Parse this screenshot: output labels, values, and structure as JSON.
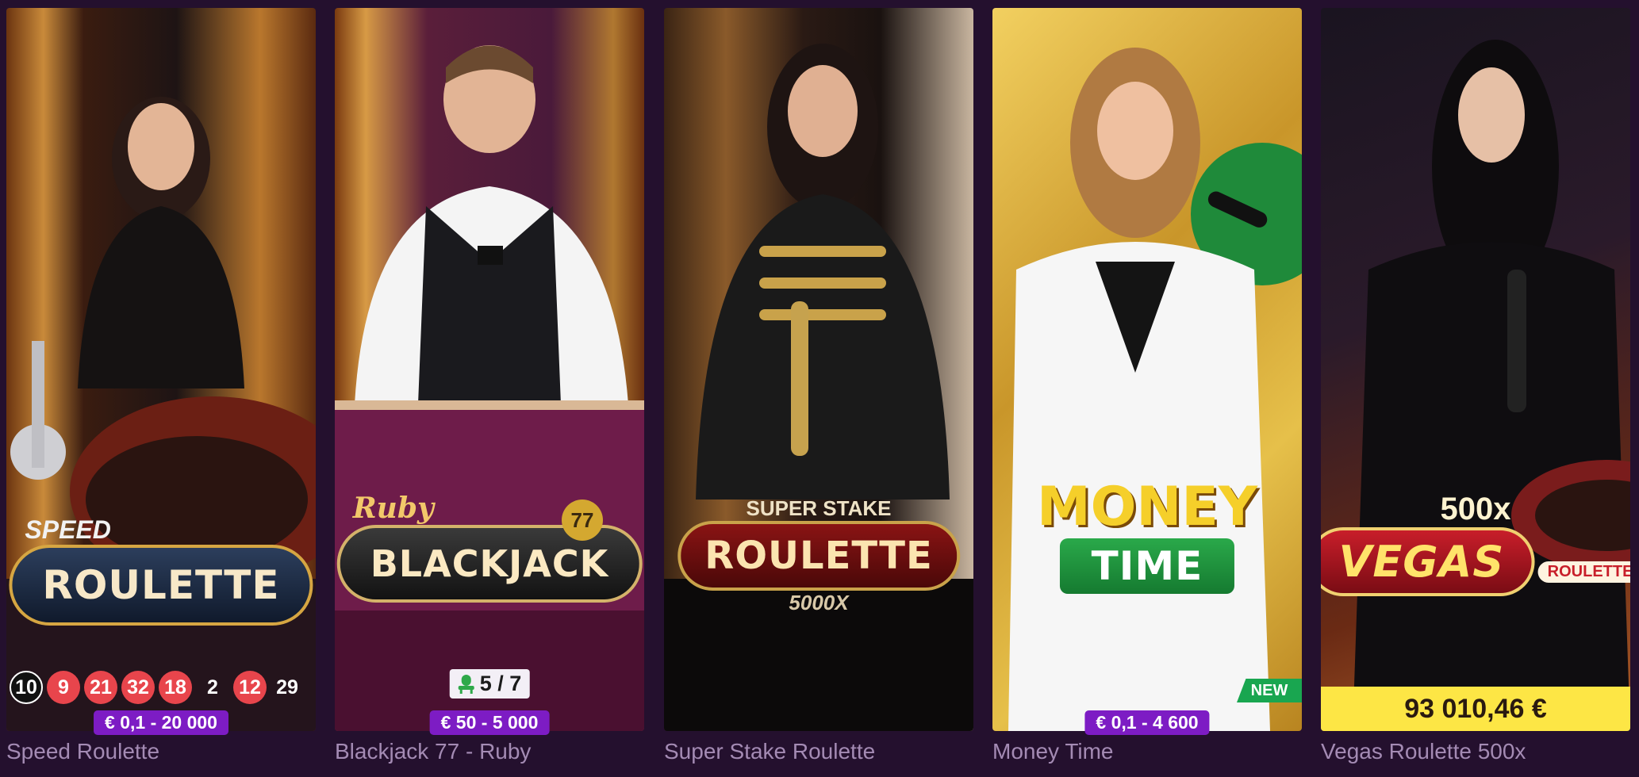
{
  "games": [
    {
      "title": "Speed Roulette",
      "logo": {
        "prefix": "SPEED",
        "main": "ROULETTE"
      },
      "recent_numbers": [
        {
          "value": "10",
          "color": "green"
        },
        {
          "value": "9",
          "color": "red"
        },
        {
          "value": "21",
          "color": "red"
        },
        {
          "value": "32",
          "color": "red"
        },
        {
          "value": "18",
          "color": "red"
        },
        {
          "value": "2",
          "color": "black"
        },
        {
          "value": "12",
          "color": "red"
        },
        {
          "value": "29",
          "color": "black"
        }
      ],
      "bet_limits": "€ 0,1 - 20 000"
    },
    {
      "title": "Blackjack 77 - Ruby",
      "logo": {
        "prefix": "Ruby",
        "main": "BLACKJACK",
        "badge": "77"
      },
      "seats": "5 / 7",
      "seat_icon": "seat-icon",
      "bet_limits": "€ 50 - 5 000"
    },
    {
      "title": "Super Stake Roulette",
      "logo": {
        "prefix": "SUPER STAKE",
        "main": "ROULETTE",
        "suffix": "5000X"
      }
    },
    {
      "title": "Money Time",
      "logo": {
        "line1": "MONEY",
        "line2": "TIME"
      },
      "badge": "NEW",
      "bet_limits": "€ 0,1 - 4 600"
    },
    {
      "title": "Vegas Roulette 500x",
      "logo": {
        "prefix": "500x",
        "main": "VEGAS",
        "suffix": "ROULETTE"
      },
      "jackpot": "93 010,46 €"
    }
  ],
  "colors": {
    "page_background": "#24102e",
    "title_text": "#a48bb4",
    "limit_badge": "#7d1cc4",
    "red_number": "#e8454c",
    "new_badge": "#19a650",
    "jackpot_bar": "#fde645"
  }
}
